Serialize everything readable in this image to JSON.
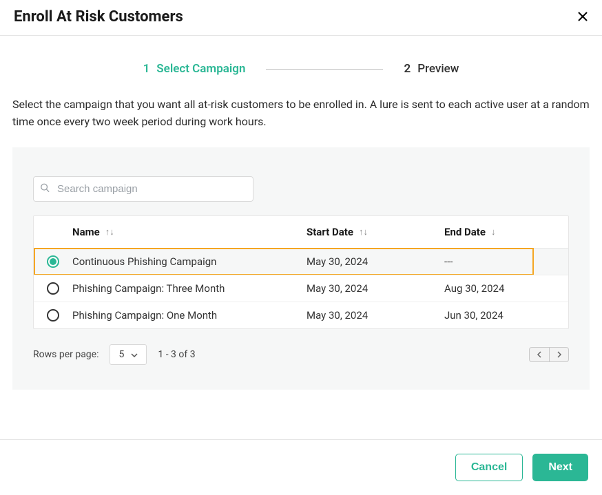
{
  "header": {
    "title": "Enroll At Risk Customers"
  },
  "stepper": {
    "step1": {
      "num": "1",
      "label": "Select Campaign"
    },
    "step2": {
      "num": "2",
      "label": "Preview"
    }
  },
  "description": "Select the campaign that you want all at-risk customers to be enrolled in. A lure is sent to each active user at a random time once every two week period during work hours.",
  "search": {
    "placeholder": "Search campaign"
  },
  "table": {
    "headers": {
      "name": "Name",
      "start": "Start Date",
      "end": "End Date"
    },
    "rows": [
      {
        "name": "Continuous Phishing Campaign",
        "start": "May 30, 2024",
        "end": "---",
        "selected": true
      },
      {
        "name": "Phishing Campaign: Three Month",
        "start": "May 30, 2024",
        "end": "Aug 30, 2024",
        "selected": false
      },
      {
        "name": "Phishing Campaign: One Month",
        "start": "May 30, 2024",
        "end": "Jun 30, 2024",
        "selected": false
      }
    ]
  },
  "pagination": {
    "rows_label": "Rows per page:",
    "rows_value": "5",
    "range": "1 - 3 of 3"
  },
  "footer": {
    "cancel": "Cancel",
    "next": "Next"
  }
}
